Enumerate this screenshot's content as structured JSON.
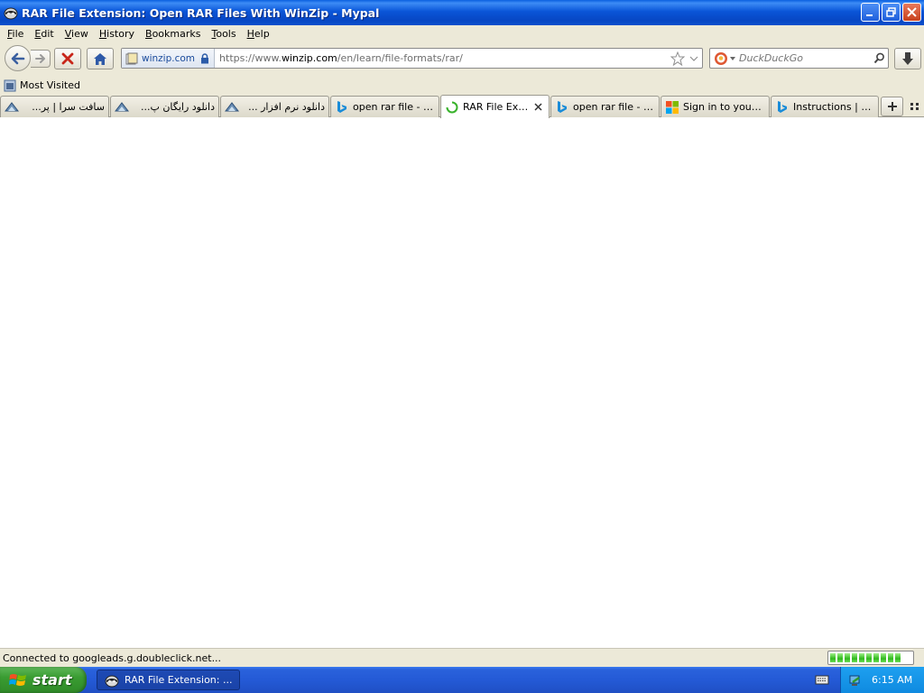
{
  "window": {
    "title": "RAR File Extension: Open RAR Files With WinZip - Mypal",
    "app_icon": "mypal-raccoon-icon"
  },
  "menu": [
    "File",
    "Edit",
    "View",
    "History",
    "Bookmarks",
    "Tools",
    "Help"
  ],
  "navigation": {
    "identity_domain": "winzip.com",
    "url_prefix": "https://www.",
    "url_host": "winzip.com",
    "url_path": "/en/learn/file-formats/rar/",
    "search_placeholder": "DuckDuckGo"
  },
  "bookmarks_bar": {
    "items": [
      {
        "label": "Most Visited",
        "icon": "bookmark-folder-icon"
      }
    ]
  },
  "tabs": [
    {
      "label": "سافت سرا | پر...",
      "icon": "site-favicon",
      "active": false
    },
    {
      "label": "دانلود رایگان پ...",
      "icon": "site-favicon",
      "active": false
    },
    {
      "label": "دانلود نرم افزار ...",
      "icon": "site-favicon",
      "active": false
    },
    {
      "label": "open rar file - Se...",
      "icon": "bing-icon",
      "active": false
    },
    {
      "label": "RAR File Exte...",
      "icon": "loading-spinner-icon",
      "active": true
    },
    {
      "label": "open rar file - Se...",
      "icon": "bing-icon",
      "active": false
    },
    {
      "label": "Sign in to your Mi...",
      "icon": "microsoft-icon",
      "active": false
    },
    {
      "label": "Instructions | Ste...",
      "icon": "bing-icon",
      "active": false
    }
  ],
  "status": {
    "text": "Connected to googleads.g.doubleclick.net...",
    "progress_fraction": 0.85
  },
  "taskbar": {
    "start_label": "start",
    "task_label": "RAR File Extension: ...",
    "clock": "6:15 AM"
  },
  "colors": {
    "titlebar_blue": "#0a55d8",
    "taskbar_blue": "#245ad6",
    "start_green": "#3a9c32",
    "tray_blue": "#0f8ae0",
    "chrome_beige": "#ece9d8"
  }
}
